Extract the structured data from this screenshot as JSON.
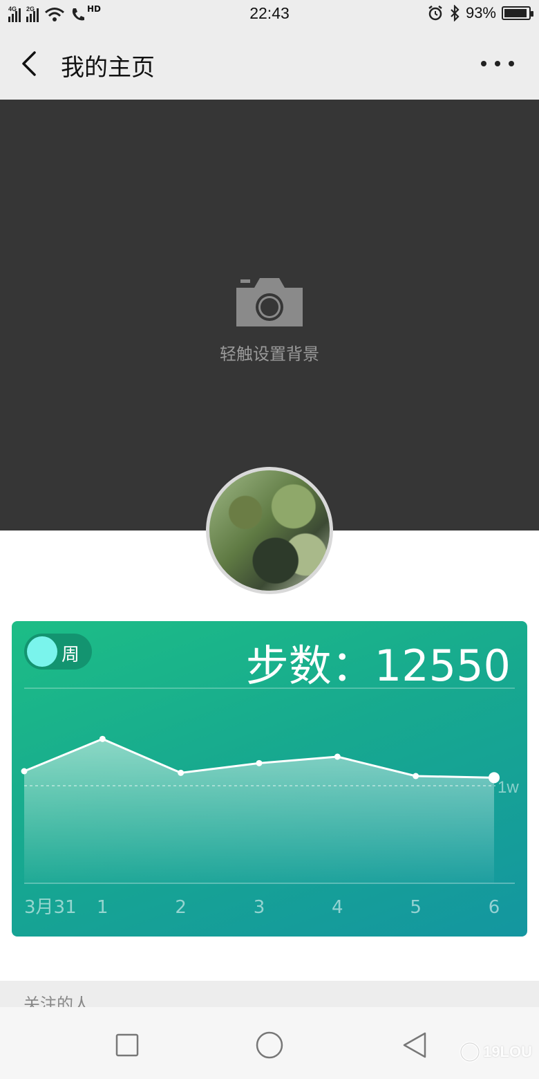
{
  "status_bar": {
    "net1": "4G",
    "net2": "2G",
    "hd": "HD",
    "time": "22:43",
    "battery_text": "93%",
    "battery_level": 0.93
  },
  "header": {
    "title": "我的主页",
    "back_icon": "chevron-left-icon",
    "more_icon": "more-dots-icon"
  },
  "cover": {
    "hint": "轻触设置背景",
    "icon": "camera-icon"
  },
  "steps_card": {
    "toggle_label": "周",
    "steps_prefix": "步数",
    "steps_separator": "：",
    "steps_value": "12550",
    "gradient_colors": [
      "#1dbd86",
      "#1496a0"
    ],
    "knob_color": "#7af4ec"
  },
  "chart_data": {
    "type": "area",
    "categories": [
      "3月31",
      "1",
      "2",
      "3",
      "4",
      "5",
      "6"
    ],
    "values": [
      10900,
      12900,
      10800,
      11400,
      11800,
      10600,
      10500
    ],
    "reference_line": {
      "value": 10000,
      "label": "1w"
    },
    "ylim": [
      4000,
      16000
    ],
    "grid": false
  },
  "following": {
    "label": "关注的人"
  },
  "nav_bar": {
    "recents_icon": "square-icon",
    "home_icon": "circle-icon",
    "back_icon": "triangle-back-icon"
  },
  "watermark": {
    "text": "19LOU"
  }
}
